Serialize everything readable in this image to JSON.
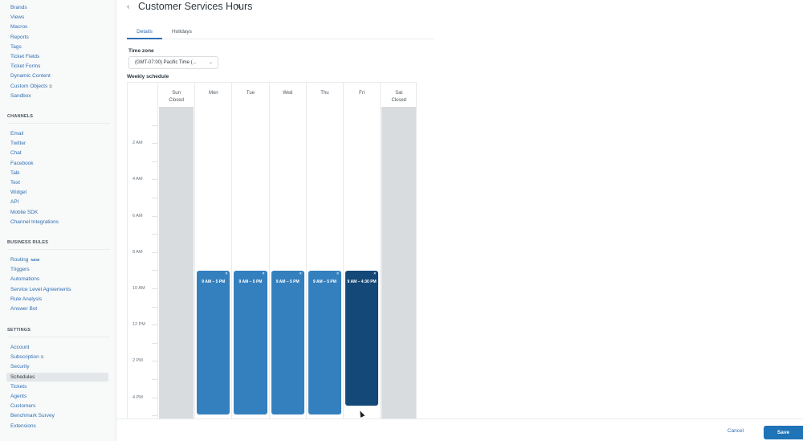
{
  "sidebar": {
    "top_items": [
      {
        "label": "Brands"
      },
      {
        "label": "Views"
      },
      {
        "label": "Macros"
      },
      {
        "label": "Reports"
      },
      {
        "label": "Tags"
      },
      {
        "label": "Ticket Fields"
      },
      {
        "label": "Ticket Forms"
      },
      {
        "label": "Dynamic Content"
      },
      {
        "label": "Custom Objects",
        "external": "⧉"
      },
      {
        "label": "Sandbox"
      }
    ],
    "channels": {
      "title": "CHANNELS",
      "items": [
        {
          "label": "Email"
        },
        {
          "label": "Twitter"
        },
        {
          "label": "Chat"
        },
        {
          "label": "Facebook"
        },
        {
          "label": "Talk"
        },
        {
          "label": "Text"
        },
        {
          "label": "Widget"
        },
        {
          "label": "API"
        },
        {
          "label": "Mobile SDK"
        },
        {
          "label": "Channel Integrations"
        }
      ]
    },
    "business_rules": {
      "title": "BUSINESS RULES",
      "items": [
        {
          "label": "Routing",
          "badge": "NEW"
        },
        {
          "label": "Triggers"
        },
        {
          "label": "Automations"
        },
        {
          "label": "Service Level Agreements"
        },
        {
          "label": "Rule Analysis"
        },
        {
          "label": "Answer Bot"
        }
      ]
    },
    "settings": {
      "title": "SETTINGS",
      "items": [
        {
          "label": "Account"
        },
        {
          "label": "Subscription",
          "external": "⧉"
        },
        {
          "label": "Security"
        },
        {
          "label": "Schedules",
          "active": true
        },
        {
          "label": "Tickets"
        },
        {
          "label": "Agents"
        },
        {
          "label": "Customers"
        },
        {
          "label": "Benchmark Survey"
        },
        {
          "label": "Extensions"
        }
      ]
    }
  },
  "header": {
    "back_icon": "‹",
    "title": "Customer Services Hours",
    "edit_icon": "✎"
  },
  "tabs": [
    {
      "label": "Details",
      "active": true
    },
    {
      "label": "Holidays",
      "active": false
    }
  ],
  "timezone": {
    "label": "Time zone",
    "value": "(GMT-07:00) Pacific Time (...",
    "chevron": "⌄"
  },
  "schedule": {
    "label": "Weekly schedule",
    "hour_labels": [
      "2 AM",
      "4 AM",
      "6 AM",
      "8 AM",
      "10 AM",
      "12 PM",
      "2 PM",
      "4 PM"
    ],
    "days": [
      {
        "name": "Sun",
        "status": "Closed",
        "closed": true
      },
      {
        "name": "Mon",
        "status": "",
        "hours": "9 AM – 5 PM"
      },
      {
        "name": "Tue",
        "status": "",
        "hours": "9 AM – 5 PM"
      },
      {
        "name": "Wed",
        "status": "",
        "hours": "9 AM – 5 PM"
      },
      {
        "name": "Thu",
        "status": "",
        "hours": "9 AM – 5 PM"
      },
      {
        "name": "Fri",
        "status": "",
        "hours": "9 AM – 4:30 PM",
        "selected": true
      },
      {
        "name": "Sat",
        "status": "Closed",
        "closed": true
      }
    ],
    "remove_icon": "×",
    "colors": {
      "block": "#3480bf",
      "block_selected": "#144878",
      "closed": "#d8dcde"
    }
  },
  "footer": {
    "cancel_label": "Cancel",
    "save_label": "Save"
  }
}
